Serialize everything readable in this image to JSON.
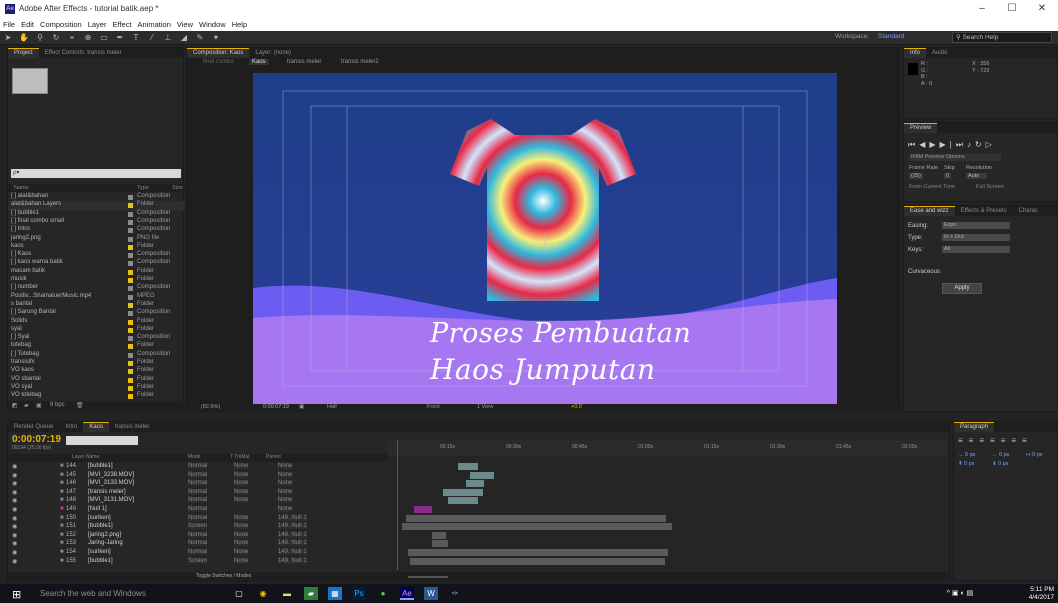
{
  "window": {
    "title": "Adobe After Effects - tutorial batik.aep *",
    "app_icon": "Ae",
    "controls": [
      "–",
      "☐",
      "✕"
    ]
  },
  "menu": [
    "File",
    "Edit",
    "Composition",
    "Layer",
    "Effect",
    "Animation",
    "View",
    "Window",
    "Help"
  ],
  "toolbar": {
    "workspace_label": "Workspace:",
    "workspace_value": "Standard",
    "search_placeholder": "Search Help"
  },
  "project": {
    "tabs": [
      "Project",
      "Effect Controls: transis meler"
    ],
    "search_placeholder": "ρ▾",
    "columns": [
      "Name",
      "Type",
      "Size"
    ],
    "items": [
      {
        "name": "[ ] alat&bahan",
        "type": "Composition",
        "color": "#8a8a8a"
      },
      {
        "name": "alat&bahan Layers",
        "type": "Folder",
        "color": "#e8c21c"
      },
      {
        "name": "[ ] bubble1",
        "type": "Composition",
        "color": "#8a8a8a"
      },
      {
        "name": "[ ] final combo small",
        "type": "Composition",
        "color": "#8a8a8a"
      },
      {
        "name": "[ ] Intro",
        "type": "Composition",
        "color": "#8a8a8a"
      },
      {
        "name": "jaring2.png",
        "type": "PNG file",
        "color": "#8a8a8a"
      },
      {
        "name": "kaos",
        "type": "Folder",
        "color": "#e8c21c"
      },
      {
        "name": "[ ] Kaos",
        "type": "Composition",
        "color": "#8a8a8a"
      },
      {
        "name": "[ ] kaos warna batik",
        "type": "Composition",
        "color": "#8a8a8a"
      },
      {
        "name": "macam batik",
        "type": "Folder",
        "color": "#e8c21c"
      },
      {
        "name": "musik",
        "type": "Folder",
        "color": "#e8c21c"
      },
      {
        "name": "[ ] number",
        "type": "Composition",
        "color": "#8a8a8a"
      },
      {
        "name": "Positiv...ShamaluerMusic.mp4",
        "type": "MPEG",
        "color": "#8a8a8a"
      },
      {
        "name": "s bantal",
        "type": "Folder",
        "color": "#e8c21c"
      },
      {
        "name": "[ ] Sarung Bantal",
        "type": "Composition",
        "color": "#8a8a8a"
      },
      {
        "name": "Solids",
        "type": "Folder",
        "color": "#e8c21c"
      },
      {
        "name": "syal",
        "type": "Folder",
        "color": "#e8c21c"
      },
      {
        "name": "[ ] Syal",
        "type": "Composition",
        "color": "#8a8a8a"
      },
      {
        "name": "totebag",
        "type": "Folder",
        "color": "#e8c21c"
      },
      {
        "name": "[ ] Totebag",
        "type": "Composition",
        "color": "#8a8a8a"
      },
      {
        "name": "transisifx",
        "type": "Folder",
        "color": "#e8c21c"
      },
      {
        "name": "VO kaos",
        "type": "Folder",
        "color": "#e8c21c"
      },
      {
        "name": "VO sbantal",
        "type": "Folder",
        "color": "#e8c21c"
      },
      {
        "name": "VO syal",
        "type": "Folder",
        "color": "#e8c21c"
      },
      {
        "name": "VO totebag",
        "type": "Folder",
        "color": "#e8c21c"
      }
    ],
    "footer_bpc": "8 bpc"
  },
  "composition": {
    "tabs": [
      "Composition: Kaos",
      "Layer: (none)"
    ],
    "breadcrumbs": [
      "final combo",
      "Kaos",
      "transis meler",
      "transis meler2"
    ],
    "title_line1": "Proses Pembuatan",
    "title_line2": "Haos Jumputan",
    "footer": {
      "zoom": "(82.6%)",
      "timecode": "0:00:07:19",
      "resolution": "Half",
      "view": "Front",
      "views": "1 View",
      "exposure": "+0.0"
    }
  },
  "info": {
    "tabs": [
      "Info",
      "Audio"
    ],
    "r": "R :",
    "g": "G :",
    "b": "B :",
    "a": "A : 0",
    "x": "X : 256",
    "y": "Y : 723"
  },
  "preview": {
    "tab": "Preview",
    "ram": "RAM Preview Options",
    "frame_rate": "Frame Rate",
    "skip": "Skip",
    "resolution": "Resolution",
    "fr_val": "(25)",
    "skip_val": "0",
    "res_val": "Auto",
    "from_current": "From Current Time",
    "full_screen": "Full Screen"
  },
  "ease": {
    "tabs": [
      "Ease and wizz",
      "Effects & Presets",
      "Charac"
    ],
    "easing": "Easing:",
    "easing_val": "Expo",
    "type": "Type:",
    "type_val": "In + Out",
    "keys": "Keys:",
    "keys_val": "All",
    "curvaceous": "Curvaceous",
    "apply": "Apply"
  },
  "paragraph": {
    "tab": "Paragraph",
    "v1": "0 px",
    "v2": "0 px",
    "v3": "0 px",
    "v4": "0 px",
    "v5": "0 px"
  },
  "timeline": {
    "tabs": [
      "Render Queue",
      "Intro",
      "Kaos",
      "transis meler"
    ],
    "timecode": "0:00:07:19",
    "fps": "00194 (25.00 fps)",
    "columns": [
      "Layer Name",
      "Mode",
      "T TrkMat",
      "Parent"
    ],
    "ticks": [
      "00:15s",
      "00:30s",
      "00:45s",
      "01:00s",
      "01:15s",
      "01:30s",
      "01:45s",
      "02:00s"
    ],
    "layers": [
      {
        "num": "144",
        "name": "[bubble1]",
        "mode": "Normal",
        "trk": "None",
        "parent": "None",
        "color": "#8a8a8a"
      },
      {
        "num": "145",
        "name": "[MVI_3238.MOV]",
        "mode": "Normal",
        "trk": "None",
        "parent": "None",
        "color": "#8a8a8a"
      },
      {
        "num": "146",
        "name": "[MVI_3133.MOV]",
        "mode": "Normal",
        "trk": "None",
        "parent": "None",
        "color": "#8a8a8a"
      },
      {
        "num": "147",
        "name": "[transis meler]",
        "mode": "Normal",
        "trk": "None",
        "parent": "None",
        "color": "#8a8a8a"
      },
      {
        "num": "148",
        "name": "[MVI_3131.MOV]",
        "mode": "Normal",
        "trk": "None",
        "parent": "None",
        "color": "#8a8a8a"
      },
      {
        "num": "149",
        "name": "[Null 1]",
        "mode": "Normal",
        "trk": "",
        "parent": "None",
        "color": "#c23aa8"
      },
      {
        "num": "150",
        "name": "[suriken]",
        "mode": "Normal",
        "trk": "None",
        "parent": "149. Null 1",
        "color": "#8a8a8a"
      },
      {
        "num": "151",
        "name": "[bubble1]",
        "mode": "Screen",
        "trk": "None",
        "parent": "149. Null 1",
        "color": "#8a8a8a"
      },
      {
        "num": "152",
        "name": "[jaring2.png]",
        "mode": "Normal",
        "trk": "None",
        "parent": "149. Null 1",
        "color": "#8a8a8a"
      },
      {
        "num": "153",
        "name": "Jaring-Jaring",
        "mode": "Normal",
        "trk": "None",
        "parent": "149. Null 1",
        "color": "#8a8a8a"
      },
      {
        "num": "154",
        "name": "[suriken]",
        "mode": "Normal",
        "trk": "None",
        "parent": "149. Null 1",
        "color": "#8a8a8a"
      },
      {
        "num": "155",
        "name": "[bubble1]",
        "mode": "Screen",
        "trk": "None",
        "parent": "149. Null 1",
        "color": "#8a8a8a"
      }
    ],
    "toggle_label": "Toggle Switches / Modes"
  },
  "taskbar": {
    "search": "Search the web and Windows",
    "time": "5:11 PM",
    "date": "4/4/2017"
  }
}
